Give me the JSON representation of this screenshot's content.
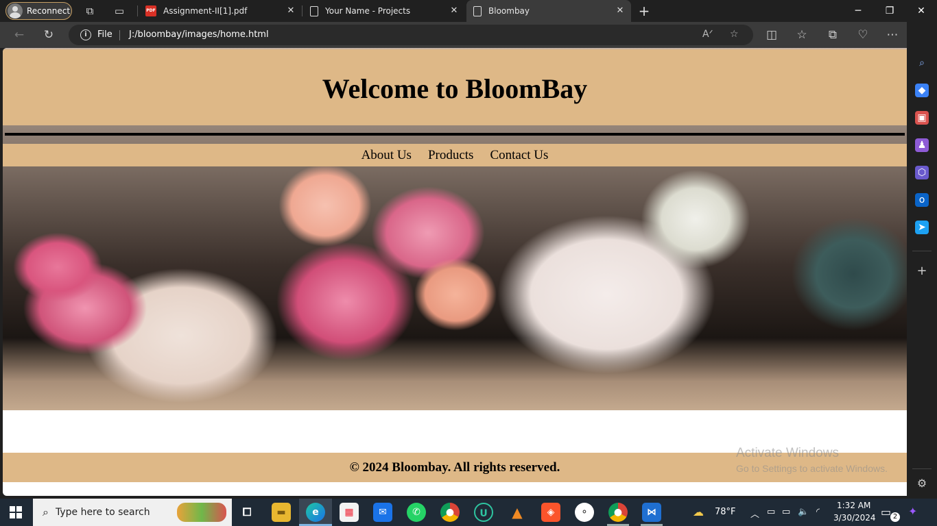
{
  "browser": {
    "profile_label": "Reconnect",
    "tabs": [
      {
        "title": "Assignment-II[1].pdf",
        "icon": "pdf-icon"
      },
      {
        "title": "Your Name - Projects",
        "icon": "page-icon"
      },
      {
        "title": "Bloombay",
        "icon": "page-icon",
        "active": true
      }
    ],
    "address": {
      "scheme_label": "File",
      "url": "J:/bloombay/images/home.html"
    }
  },
  "page": {
    "title": "Welcome to BloomBay",
    "nav": [
      "About Us",
      "Products",
      "Contact Us"
    ],
    "footer": "© 2024 Bloombay. All rights reserved.",
    "colors": {
      "band": "#deb887"
    }
  },
  "watermark": {
    "line1": "Activate Windows",
    "line2": "Go to Settings to activate Windows."
  },
  "taskbar": {
    "search_placeholder": "Type here to search",
    "weather": "78°F",
    "time": "1:32 AM",
    "date": "3/30/2024",
    "notification_count": "2"
  }
}
